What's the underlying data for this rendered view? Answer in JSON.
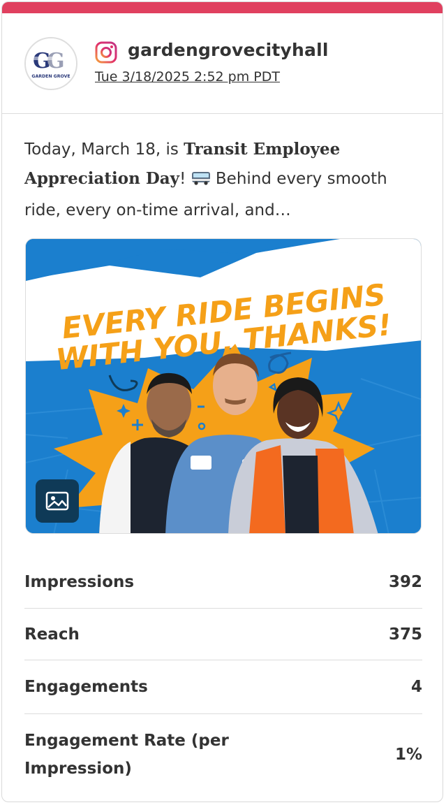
{
  "post": {
    "username": "gardengrovecityhall",
    "timestamp": "Tue 3/18/2025 2:52 pm PDT",
    "network_icon": "instagram-icon",
    "avatar_logo_text": "GARDEN GROVE",
    "text": {
      "part1": "Today, March 18, is ",
      "bold": "Transit Employee Appreciation Day",
      "part2": "! ",
      "emoji": "bus-emoji",
      "part3": " Behind every smooth ride, every on-time arrival, and…"
    },
    "media": {
      "headline_line1": "EVERY RIDE BEGINS",
      "headline_line2": "WITH YOU, THANKS!",
      "badge_icon": "image-icon"
    }
  },
  "stats": [
    {
      "label": "Impressions",
      "value": "392"
    },
    {
      "label": "Reach",
      "value": "375"
    },
    {
      "label": "Engagements",
      "value": "4"
    },
    {
      "label": "Engagement Rate (per Impression)",
      "value": "1%"
    }
  ],
  "colors": {
    "accent": "#e0405f",
    "text": "#333333",
    "media_blue": "#1b7fce",
    "media_orange": "#f5a018"
  }
}
